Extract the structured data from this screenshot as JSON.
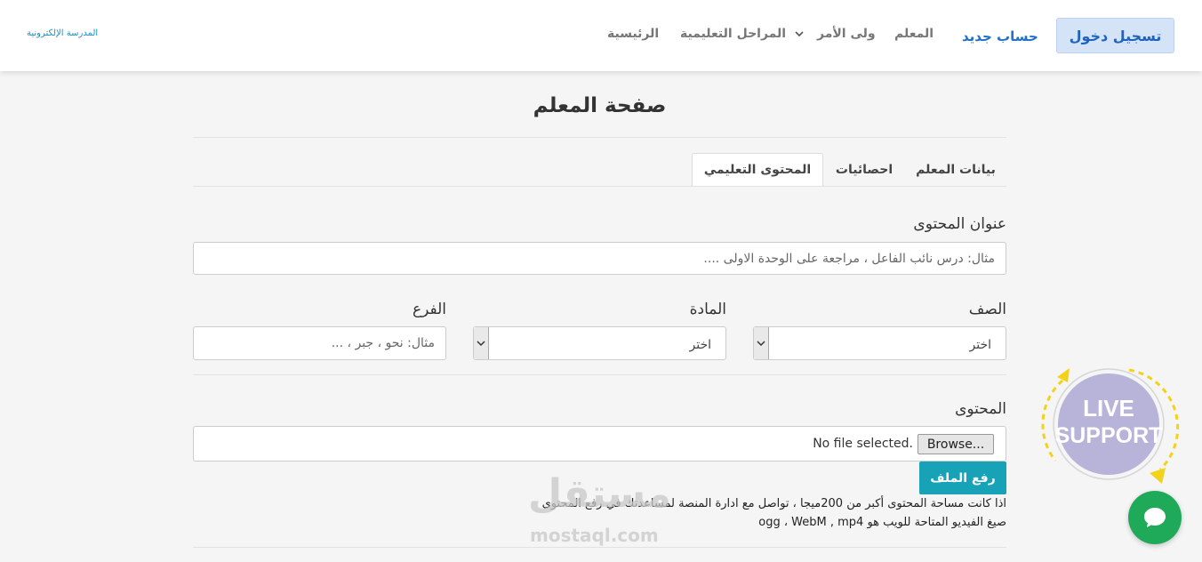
{
  "navbar": {
    "brand": "المدرسة الإلكترونية",
    "login": "تسجيل دخول",
    "register": "حساب جديد",
    "teacher": "المعلم",
    "guardian": "ولى الأمر",
    "stages": "المراحل التعليمية",
    "home": "الرئيسية"
  },
  "page": {
    "title": "صفحة المعلم"
  },
  "tabs": [
    {
      "label": "بيانات المعلم"
    },
    {
      "label": "احصائيات"
    },
    {
      "label": "المحتوى التعليمي"
    }
  ],
  "form": {
    "title_label": "عنوان المحتوى",
    "title_placeholder": "مثال: درس نائب الفاعل ، مراجعة على الوحدة الاولى ....",
    "grade_label": "الصف",
    "grade_value": "اختر",
    "subject_label": "المادة",
    "subject_value": "اختر",
    "branch_label": "الفرع",
    "branch_placeholder": "مثال: نحو ، جبر ، ...",
    "content_label": "المحتوى",
    "browse_label": "Browse...",
    "no_file": "No file selected.",
    "upload_label": "رفع الملف",
    "note_1": "اذا كانت مساحة المحتوى أكبر من 200ميجا ، تواصل مع ادارة المنصة لمساعدتك في رفع المحتوى",
    "note_2": "صيغ الفيديو المتاحة للويب هو ogg ، WebM , mp4"
  },
  "watermark": {
    "arabic": "مستقل",
    "latin": "mostaql.com"
  },
  "support": {
    "line1": "LIVE",
    "line2": "SUPPORT"
  },
  "colors": {
    "accent": "#2270c9",
    "upload": "#17a2b8",
    "chat": "#1faa5a",
    "support_badge": "#b7b3d9",
    "support_arrows": "#f2d21b"
  }
}
